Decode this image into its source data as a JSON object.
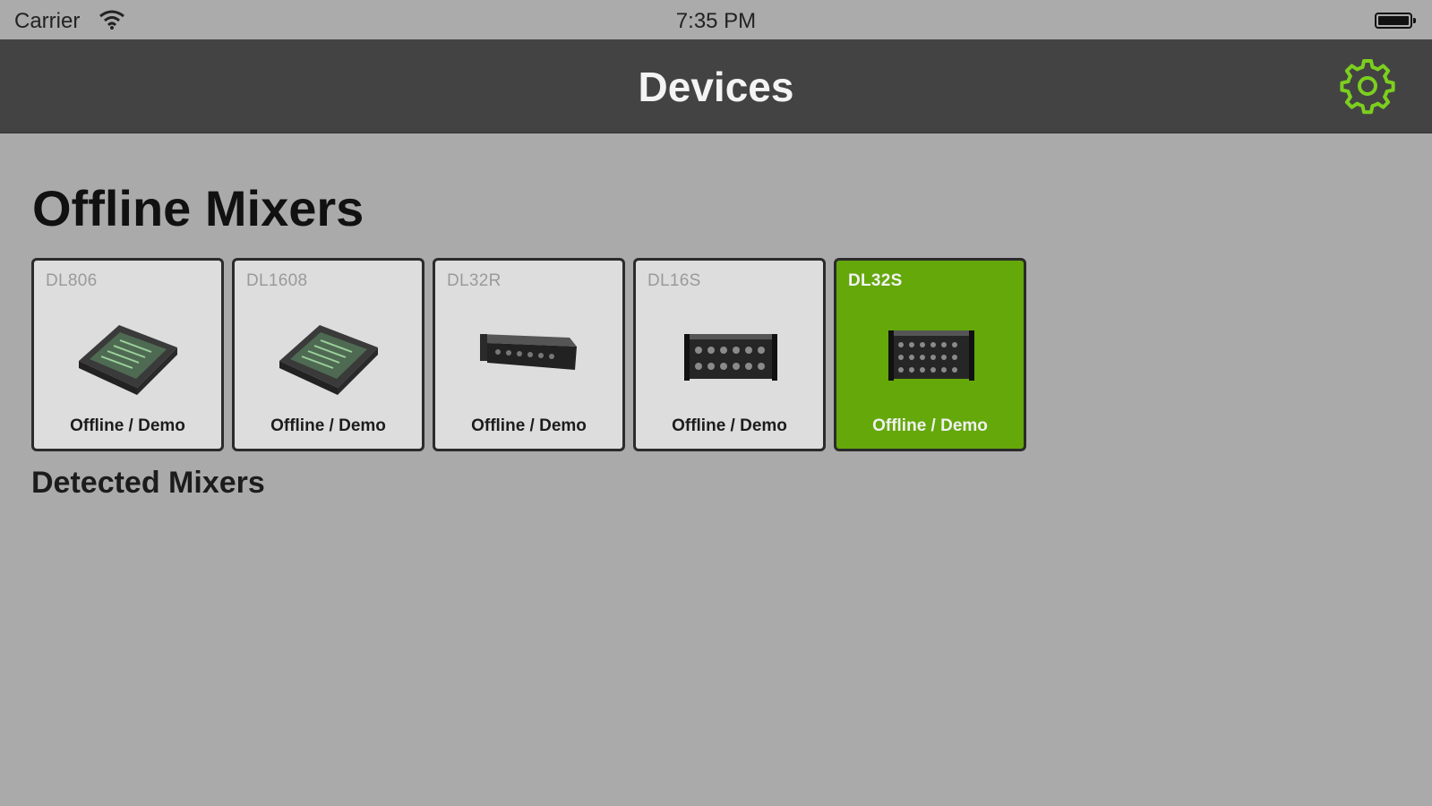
{
  "status_bar": {
    "carrier": "Carrier",
    "time": "7:35 PM"
  },
  "nav": {
    "title": "Devices",
    "settings_icon": "gear-icon",
    "accent_color": "#7ccf1e"
  },
  "offline_section": {
    "title": "Offline Mixers",
    "mixers": [
      {
        "model": "DL806",
        "status": "Offline / Demo",
        "selected": false,
        "image": "tabletop-mixer"
      },
      {
        "model": "DL1608",
        "status": "Offline / Demo",
        "selected": false,
        "image": "tabletop-mixer"
      },
      {
        "model": "DL32R",
        "status": "Offline / Demo",
        "selected": false,
        "image": "rack-mixer"
      },
      {
        "model": "DL16S",
        "status": "Offline / Demo",
        "selected": false,
        "image": "rack-mixer-tall"
      },
      {
        "model": "DL32S",
        "status": "Offline / Demo",
        "selected": true,
        "image": "rack-mixer-tall"
      }
    ]
  },
  "detected_section": {
    "title": "Detected Mixers"
  },
  "colors": {
    "background": "#aaaaaa",
    "nav_bar": "#434343",
    "card": "#dddddd",
    "selected_card": "#64a80a"
  }
}
